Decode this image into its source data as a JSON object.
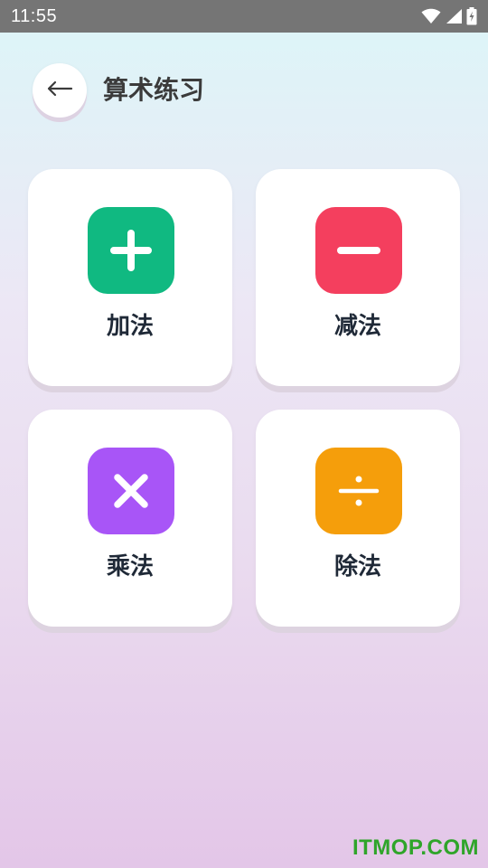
{
  "status_bar": {
    "time": "11:55",
    "icons": [
      "wifi-icon",
      "signal-icon",
      "battery-charging-icon"
    ]
  },
  "header": {
    "back_icon": "back-arrow-icon",
    "title": "算术练习"
  },
  "cards": [
    {
      "label": "加法",
      "icon": "plus-icon",
      "color": "#10b981"
    },
    {
      "label": "减法",
      "icon": "minus-icon",
      "color": "#f43f5e"
    },
    {
      "label": "乘法",
      "icon": "multiply-icon",
      "color": "#a855f7"
    },
    {
      "label": "除法",
      "icon": "divide-icon",
      "color": "#f59e0b"
    }
  ],
  "watermark": "ITMOP.COM"
}
